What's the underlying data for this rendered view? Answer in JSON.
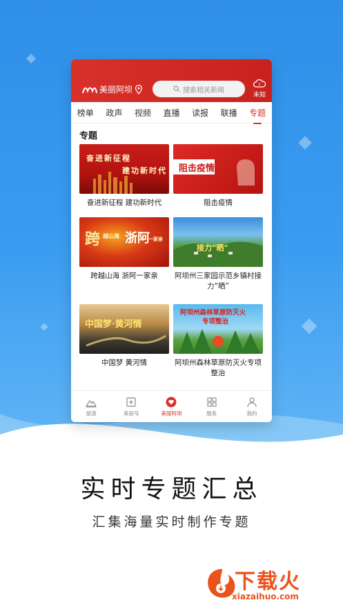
{
  "app": {
    "logo_text": "美丽阿坝",
    "search_placeholder": "搜索相关新闻",
    "weather_label": "未知"
  },
  "tabs": [
    {
      "label": "榜单",
      "active": false
    },
    {
      "label": "政声",
      "active": false
    },
    {
      "label": "视频",
      "active": false
    },
    {
      "label": "直播",
      "active": false
    },
    {
      "label": "读报",
      "active": false
    },
    {
      "label": "联播",
      "active": false
    },
    {
      "label": "专题",
      "active": true
    }
  ],
  "section_title": "专题",
  "cards": [
    {
      "label": "奋进新征程 建功新时代",
      "thumb_text_1": "奋进新征程",
      "thumb_text_2": "建功新时代"
    },
    {
      "label": "阻击疫情",
      "thumb_text_1": "阻击疫情"
    },
    {
      "label": "跨越山海 浙阿一家亲",
      "thumb_text_1": "跨",
      "thumb_text_2": "越山海",
      "thumb_text_3": "浙阿",
      "thumb_text_4": "一家亲"
    },
    {
      "label": "阿坝州三家园示范乡镇村接力“晒”",
      "thumb_text_1": "接力“晒”"
    },
    {
      "label": "中国梦 黄河情",
      "thumb_text_1": "中国梦·黄河情"
    },
    {
      "label": "阿坝州森林草原防灭火专项整治",
      "thumb_text_1": "阿坝州森林草原防灭火",
      "thumb_text_2": "专项整治"
    }
  ],
  "bottom_nav": [
    {
      "label": "旅游",
      "icon": "mountain-icon",
      "active": false
    },
    {
      "label": "美丽号",
      "icon": "plus-box-icon",
      "active": false
    },
    {
      "label": "美丽阿坝",
      "icon": "heart-icon",
      "active": true
    },
    {
      "label": "服务",
      "icon": "grid-icon",
      "active": false
    },
    {
      "label": "我的",
      "icon": "user-icon",
      "active": false
    }
  ],
  "promo": {
    "headline": "实时专题汇总",
    "subline": "汇集海量实时制作专题"
  },
  "watermark": {
    "text": "下载火",
    "url": "xiazaihuo.com"
  },
  "colors": {
    "brand_red": "#d8312b",
    "background_blue": "#3a9cf0",
    "watermark_orange": "#e9541d"
  }
}
